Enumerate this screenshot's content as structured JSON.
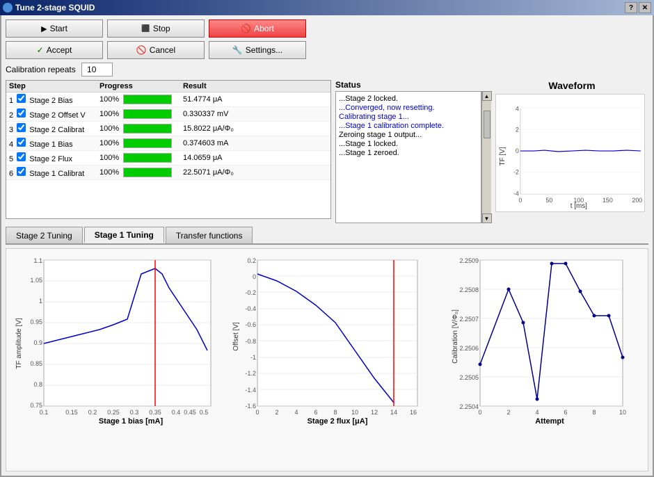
{
  "window": {
    "title": "Tune 2-stage SQUID"
  },
  "toolbar": {
    "start_label": "Start",
    "stop_label": "Stop",
    "abort_label": "Abort",
    "accept_label": "Accept",
    "cancel_label": "Cancel",
    "settings_label": "Settings..."
  },
  "calibration": {
    "label": "Calibration repeats",
    "value": "10"
  },
  "table": {
    "columns": [
      "Step",
      "Progress",
      "Result"
    ],
    "rows": [
      {
        "num": "1",
        "checked": true,
        "name": "Stage 2 Bias",
        "progress": 100,
        "result": "51.4774 μA"
      },
      {
        "num": "2",
        "checked": true,
        "name": "Stage 2 Offset V",
        "progress": 100,
        "result": "0.330337 mV"
      },
      {
        "num": "3",
        "checked": true,
        "name": "Stage 2 Calibrat",
        "progress": 100,
        "result": "15.8022 μA/Φ₀"
      },
      {
        "num": "4",
        "checked": true,
        "name": "Stage 1 Bias",
        "progress": 100,
        "result": "0.374603 mA"
      },
      {
        "num": "5",
        "checked": true,
        "name": "Stage 2 Flux",
        "progress": 100,
        "result": "14.0659 μA"
      },
      {
        "num": "6",
        "checked": true,
        "name": "Stage 1 Calibrat",
        "progress": 100,
        "result": "22.5071 μA/Φ₀"
      }
    ]
  },
  "status": {
    "label": "Status",
    "lines": [
      {
        "text": "...Stage 2 locked.",
        "type": "normal"
      },
      {
        "text": "...Converged, now resetting.",
        "type": "blue"
      },
      {
        "text": "Calibrating stage 1...",
        "type": "blue"
      },
      {
        "text": "...Stage 1 calibration complete.",
        "type": "blue"
      },
      {
        "text": "Zeroing stage 1 output...",
        "type": "normal"
      },
      {
        "text": "...Stage 1 locked.",
        "type": "normal"
      },
      {
        "text": "...Stage 1 zeroed.",
        "type": "normal"
      }
    ]
  },
  "waveform": {
    "title": "Waveform",
    "y_label": "TF [V]",
    "x_label": "t [ms]",
    "y_min": -4,
    "y_max": 4,
    "x_min": 0,
    "x_max": 200
  },
  "tabs": [
    {
      "label": "Stage 2 Tuning",
      "active": false
    },
    {
      "label": "Stage 1 Tuning",
      "active": true
    },
    {
      "label": "Transfer functions",
      "active": false
    }
  ],
  "chart1": {
    "title": "",
    "x_label": "Stage 1 bias [mA]",
    "y_label": "TF amplitude [V]",
    "x_ticks": [
      "0.1",
      "0.15",
      "0.2",
      "0.25",
      "0.3",
      "0.35",
      "0.4",
      "0.45",
      "0.5"
    ],
    "y_ticks": [
      "0.75",
      "0.8",
      "0.85",
      "0.9",
      "0.95",
      "1",
      "1.05",
      "1.1"
    ],
    "red_line_x": 0.35
  },
  "chart2": {
    "x_label": "Stage 2 flux [μA]",
    "y_label": "Offset [V]",
    "x_ticks": [
      "0",
      "2",
      "4",
      "6",
      "8",
      "10",
      "12",
      "14",
      "16"
    ],
    "y_ticks": [
      "-1.6",
      "-1.4",
      "-1.2",
      "-1",
      "-0.8",
      "-0.6",
      "-0.4",
      "-0.2",
      "0",
      "0.2"
    ],
    "red_line_x": 14
  },
  "chart3": {
    "x_label": "Attempt",
    "y_label": "Calibration [V/Φ₀]",
    "x_ticks": [
      "0",
      "2",
      "4",
      "6",
      "8",
      "10"
    ],
    "y_ticks": [
      "2.2504",
      "2.2505",
      "2.2506",
      "2.2507",
      "2.2508",
      "2.2509"
    ]
  }
}
